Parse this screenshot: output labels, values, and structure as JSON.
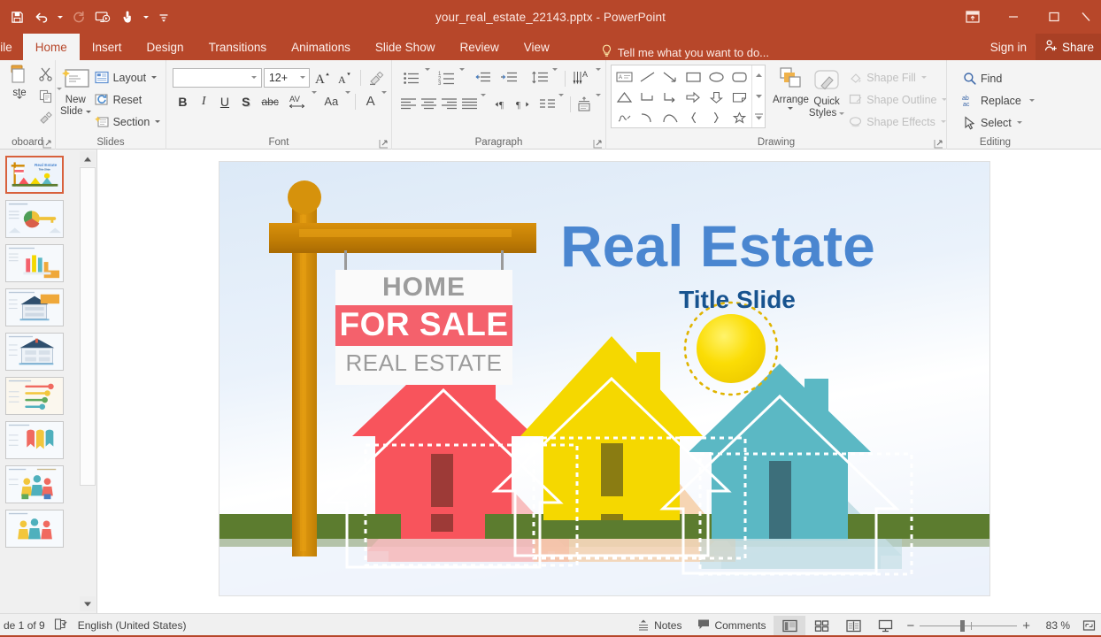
{
  "window": {
    "title": "your_real_estate_22143.pptx - PowerPoint",
    "quick_access": [
      {
        "name": "save",
        "label": "Save"
      },
      {
        "name": "undo",
        "label": "Undo"
      },
      {
        "name": "redo",
        "label": "Repeat"
      },
      {
        "name": "start-from-beginning",
        "label": "Start From Beginning"
      },
      {
        "name": "touch-mouse-mode",
        "label": "Touch/Mouse Mode"
      },
      {
        "name": "customize-qat",
        "label": "Customize Quick Access Toolbar"
      }
    ],
    "controls": {
      "ribbon_display": "Ribbon Display Options",
      "minimize": "Minimize",
      "restore": "Restore Down",
      "close": "Close"
    }
  },
  "ribbon": {
    "tabs": [
      {
        "label": "File",
        "active": false
      },
      {
        "label": "Home",
        "active": true
      },
      {
        "label": "Insert",
        "active": false
      },
      {
        "label": "Design",
        "active": false
      },
      {
        "label": "Transitions",
        "active": false
      },
      {
        "label": "Animations",
        "active": false
      },
      {
        "label": "Slide Show",
        "active": false
      },
      {
        "label": "Review",
        "active": false
      },
      {
        "label": "View",
        "active": false
      }
    ],
    "tell_me": "Tell me what you want to do...",
    "sign_in": "Sign in",
    "share": "Share",
    "groups": {
      "clipboard": {
        "label": "oboard",
        "paste": "ste",
        "cut": "Cut",
        "copy": "Copy",
        "format_painter": "Format Painter"
      },
      "slides": {
        "label": "Slides",
        "new_slide": "New\nSlide",
        "new_slide_line1": "New",
        "new_slide_line2": "Slide",
        "layout": "Layout",
        "reset": "Reset",
        "section": "Section"
      },
      "font": {
        "label": "Font",
        "font_name": "",
        "font_name_placeholder": "",
        "font_size": "12+",
        "bold": "B",
        "italic": "I",
        "underline": "U",
        "shadow": "S",
        "strikethrough": "abc",
        "character_spacing": "AV",
        "change_case": "Aa",
        "font_color": "A",
        "increase_font": "A",
        "decrease_font": "A",
        "clear_formatting": "Clear All Formatting"
      },
      "paragraph": {
        "label": "Paragraph",
        "bullets": "Bullets",
        "numbering": "Numbering",
        "decrease_indent": "Decrease List Level",
        "increase_indent": "Increase List Level",
        "line_spacing": "Line Spacing",
        "align_left": "Align Left",
        "center": "Center",
        "align_right": "Align Right",
        "justify": "Justify",
        "text_direction": "Text Direction",
        "rtl": "Right to Left",
        "columns": "Columns",
        "vertical_text": "Text Direction",
        "align_text": "Align Text",
        "convert_smartart": "Convert to SmartArt"
      },
      "drawing": {
        "label": "Drawing",
        "arrange": "Arrange",
        "quick_styles_line1": "Quick",
        "quick_styles_line2": "Styles",
        "shape_fill": "Shape Fill",
        "shape_outline": "Shape Outline",
        "shape_effects": "Shape Effects"
      },
      "editing": {
        "label": "Editing",
        "find": "Find",
        "replace": "Replace",
        "select": "Select"
      }
    }
  },
  "slide": {
    "sign": {
      "line1": "HOME",
      "line2": "FOR SALE",
      "line3": "REAL ESTATE"
    },
    "title": "Real Estate",
    "subtitle": "Title Slide",
    "colors": {
      "title": "#4a86d0",
      "subtitle": "#17538f",
      "for_sale_bg": "#f4616c",
      "sign_text": "#9c9c9c",
      "post": "#d18800",
      "house_red": "#f8545c",
      "house_yellow": "#f5d800",
      "house_teal": "#5bb8c4",
      "grass": "#5c7c2f",
      "sun": "#f6d900"
    }
  },
  "thumbnails": {
    "count": 9,
    "selected": 1
  },
  "status": {
    "slide_indicator": "de 1 of 9",
    "language": "English (United States)",
    "notes": "Notes",
    "comments": "Comments",
    "views": [
      {
        "name": "normal-view",
        "label": "Normal",
        "active": true
      },
      {
        "name": "slide-sorter-view",
        "label": "Slide Sorter",
        "active": false
      },
      {
        "name": "reading-view",
        "label": "Reading View",
        "active": false
      },
      {
        "name": "slide-show-view",
        "label": "Slide Show",
        "active": false
      }
    ],
    "zoom_out": "−",
    "zoom_in": "+",
    "zoom_level": "83 %",
    "fit_to_window": "Fit slide to current window"
  }
}
